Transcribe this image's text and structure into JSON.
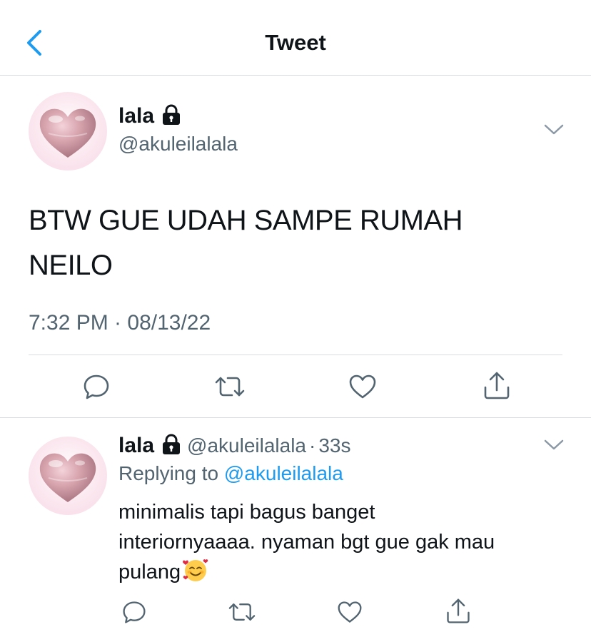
{
  "header": {
    "title": "Tweet",
    "back_icon": "chevron-left-icon"
  },
  "colors": {
    "accent": "#1d9bf0",
    "text": "#0f1419",
    "muted": "#536471",
    "divider": "#d9dde1",
    "avatar_bg": "#fbe7ef"
  },
  "tweet": {
    "name": "lala",
    "handle": "@akuleilalala",
    "text_line1": "BTW GUE UDAH SAMPE RUMAH",
    "text_line2": "NEILO",
    "timestamp": "7:32 PM · 08/13/22",
    "icons": [
      "lock-icon",
      "chevron-down-icon",
      "reply-icon",
      "retweet-icon",
      "like-icon",
      "share-icon"
    ]
  },
  "reply": {
    "name": "lala",
    "handle": "@akuleilalala",
    "separator": "·",
    "time": "33s",
    "replying_prefix": "Replying to ",
    "replying_handle": "@akuleilalala",
    "text_line1": "minimalis tapi bagus banget",
    "text_line2": "interiornyaaaa. nyaman bgt gue gak mau",
    "text_line3": "pulang",
    "emoji": "smiling-face-with-hearts"
  }
}
